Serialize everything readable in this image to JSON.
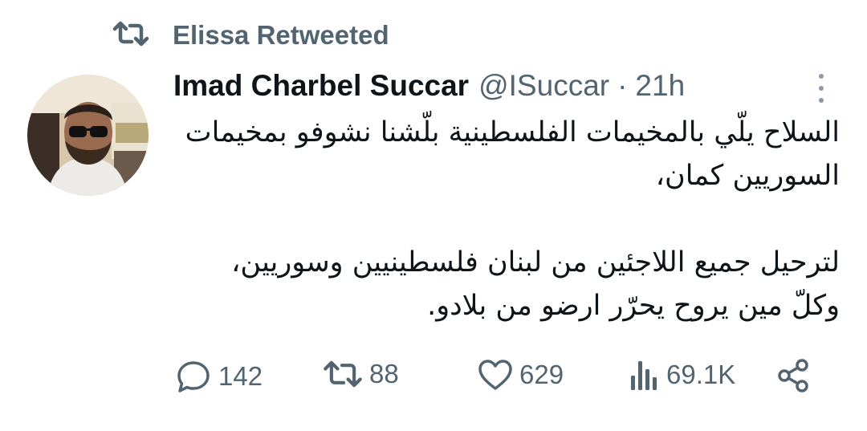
{
  "retweet_context": {
    "label": "Elissa Retweeted",
    "icon": "retweet-icon"
  },
  "tweet": {
    "author_name": "Imad Charbel Succar",
    "handle": "@ISuccar",
    "separator": "·",
    "time": "21h",
    "lines": [
      "السلاح يلّي بالمخيمات الفلسطينية بلّشنا نشوفو بمخيمات",
      "السوريين كمان،",
      "لترحيل جميع اللاجئين من لبنان فلسطينيين وسوريين،",
      "وكلّ مين يروح يحرّر ارضو من بلادو."
    ]
  },
  "actions": {
    "replies": {
      "icon": "reply-icon",
      "count": "142"
    },
    "retweets": {
      "icon": "retweet-icon",
      "count": "88"
    },
    "likes": {
      "icon": "heart-icon",
      "count": "629"
    },
    "views": {
      "icon": "views-icon",
      "count": "69.1K"
    },
    "share": {
      "icon": "share-icon"
    }
  },
  "colors": {
    "text": "#0f1419",
    "secondary": "#536471",
    "background": "#ffffff"
  }
}
